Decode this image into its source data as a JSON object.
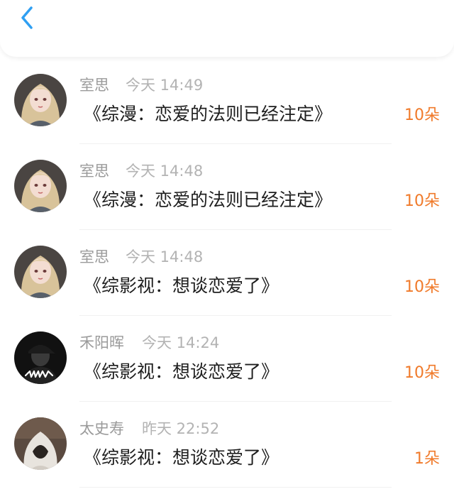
{
  "header": {
    "back_icon": "chevron-left-icon",
    "accent_color": "#2f9ff2"
  },
  "colors": {
    "amount": "#f07a2a",
    "name": "#9a9a9a",
    "time": "#b3b3b3",
    "title": "#1e1e1e"
  },
  "records": [
    {
      "name": "室思",
      "time": "今天 14:49",
      "title": "《综漫：恋爱的法则已经注定》",
      "amount": "10朵",
      "avatar": "girl-avatar"
    },
    {
      "name": "室思",
      "time": "今天 14:48",
      "title": "《综漫：恋爱的法则已经注定》",
      "amount": "10朵",
      "avatar": "girl-avatar"
    },
    {
      "name": "室思",
      "time": "今天 14:48",
      "title": "《综影视：想谈恋爱了》",
      "amount": "10朵",
      "avatar": "girl-avatar"
    },
    {
      "name": "禾阳晖",
      "time": "今天 14:24",
      "title": "《综影视：想谈恋爱了》",
      "amount": "10朵",
      "avatar": "cap-man-avatar"
    },
    {
      "name": "太史寿",
      "time": "昨天 22:52",
      "title": "《综影视：想谈恋爱了》",
      "amount": "1朵",
      "avatar": "hooded-figure-avatar"
    }
  ]
}
